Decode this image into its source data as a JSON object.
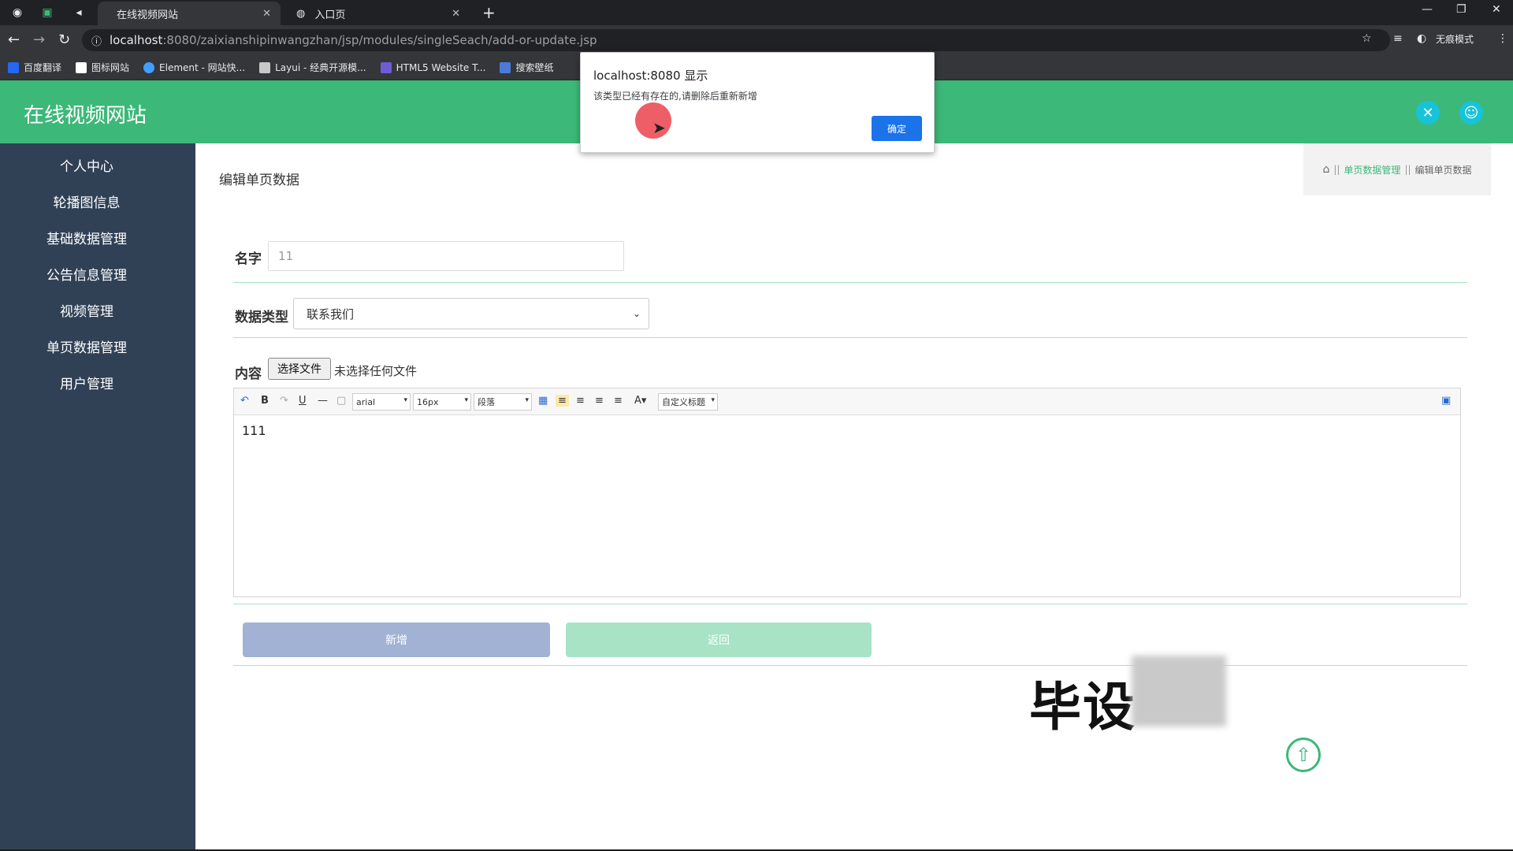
{
  "browser": {
    "tabs": [
      {
        "title": "在线视频网站",
        "active": true
      },
      {
        "title": "入口页",
        "active": false
      }
    ],
    "url_host": "localhost",
    "url_path": ":8080/zaixianshipinwangzhan/jsp/modules/singleSeach/add-or-update.jsp",
    "incognito_label": "无痕模式",
    "bookmarks": [
      {
        "label": "百度翻译",
        "color": "#2468f2"
      },
      {
        "label": "图标网站",
        "color": "#ffffff"
      },
      {
        "label": "Element - 网站快...",
        "color": "#409eff"
      },
      {
        "label": "Layui - 经典开源模...",
        "color": "#c8c8c8"
      },
      {
        "label": "HTML5 Website T...",
        "color": "#6f5bd4"
      },
      {
        "label": "搜索壁纸",
        "color": "#4a7bd9"
      }
    ]
  },
  "app": {
    "site_title": "在线视频网站",
    "accent": "#3cb878",
    "sidebar": {
      "items": [
        {
          "label": "个人中心"
        },
        {
          "label": "轮播图信息"
        },
        {
          "label": "基础数据管理"
        },
        {
          "label": "公告信息管理"
        },
        {
          "label": "视频管理"
        },
        {
          "label": "单页数据管理"
        },
        {
          "label": "用户管理"
        }
      ]
    },
    "page_title": "编辑单页数据",
    "breadcrumb": {
      "link": "单页数据管理",
      "current": "编辑单页数据",
      "separator": "||"
    },
    "form": {
      "name_label": "名字",
      "name_value": "11",
      "type_label": "数据类型",
      "type_value": "联系我们",
      "content_label": "内容",
      "file_button": "选择文件",
      "file_note": "未选择任何文件",
      "editor": {
        "font_family": "arial",
        "font_size": "16px",
        "paragraph": "段落",
        "custom_title": "自定义标题",
        "content": "111"
      },
      "submit_label": "新增",
      "back_label": "返回"
    },
    "watermark": "毕设"
  },
  "dialog": {
    "title": "localhost:8080 显示",
    "message": "该类型已经有存在的,请删除后重新新增",
    "ok_label": "确定"
  }
}
